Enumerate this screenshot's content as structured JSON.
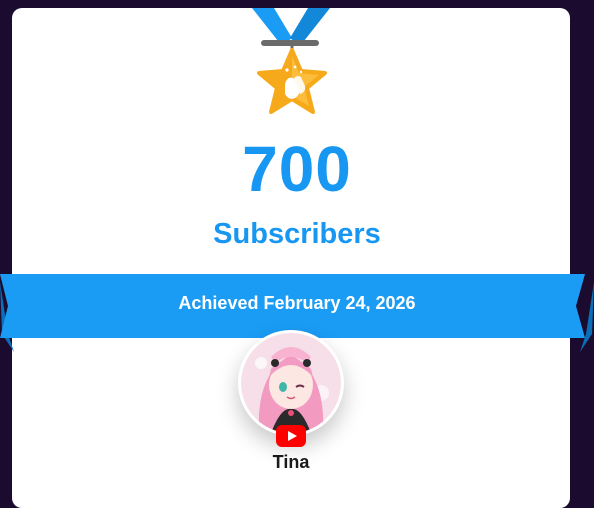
{
  "milestone": {
    "count": "700",
    "unit_label": "Subscribers",
    "achieved_text": "Achieved February 24, 2026"
  },
  "channel": {
    "name": "Tina",
    "platform_icon": "youtube-icon"
  },
  "icons": {
    "medal": "star-medal-clapping-icon"
  },
  "colors": {
    "accent": "#1797f2",
    "banner": "#1a9cf5",
    "banner_dark": "#0a6fb8",
    "background": "#1b0b2e",
    "medal_gold": "#f7a91c",
    "youtube_red": "#ff0000"
  }
}
